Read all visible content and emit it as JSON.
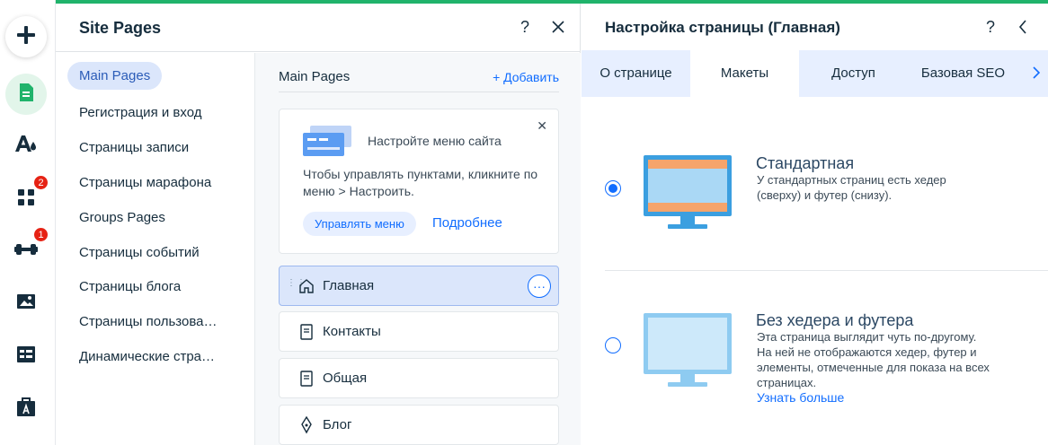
{
  "colors": {
    "accent": "#116dff",
    "brand_green": "#20b36b",
    "badge_red": "#e62214",
    "tab_bar_bg": "#e7efff"
  },
  "rail": {
    "items": [
      {
        "name": "add-icon"
      },
      {
        "name": "pages-icon"
      },
      {
        "name": "design-icon"
      },
      {
        "name": "apps-icon",
        "badge": "2"
      },
      {
        "name": "business-icon",
        "badge": "1"
      },
      {
        "name": "media-icon"
      },
      {
        "name": "cms-icon"
      },
      {
        "name": "portfolio-icon"
      }
    ]
  },
  "site_pages": {
    "title": "Site Pages",
    "help": "?",
    "categories": [
      "Main Pages",
      "Регистрация и вход",
      "Страницы записи",
      "Страницы марафона",
      "Groups Pages",
      "Страницы событий",
      "Страницы блога",
      "Страницы пользова…",
      "Динамические стра…"
    ],
    "list_title": "Main Pages",
    "add_label": "+ Добавить",
    "info": {
      "title": "Настройте меню сайта",
      "text": "Чтобы управлять пунктами, кликните по меню > Настроить.",
      "button": "Управлять меню",
      "link": "Подробнее"
    },
    "pages": [
      {
        "label": "Главная",
        "icon": "home-icon"
      },
      {
        "label": "Контакты",
        "icon": "page-icon"
      },
      {
        "label": "Общая",
        "icon": "page-icon"
      },
      {
        "label": "Блог",
        "icon": "pen-icon"
      }
    ]
  },
  "page_settings": {
    "title": "Настройка страницы (Главная)",
    "help": "?",
    "tabs": [
      "О странице",
      "Макеты",
      "Доступ",
      "Базовая SEO"
    ],
    "active_tab": "Макеты",
    "layouts": [
      {
        "title": "Стандартная",
        "desc": "У стандартных страниц есть хедер (сверху) и футер (снизу).",
        "selected": true
      },
      {
        "title": "Без хедера и футера",
        "desc": "Эта страница выглядит чуть по-другому. На ней не отображаются хедер, футер и элементы, отмеченные для показа на всех страницах.",
        "link": "Узнать больше",
        "selected": false
      }
    ]
  }
}
